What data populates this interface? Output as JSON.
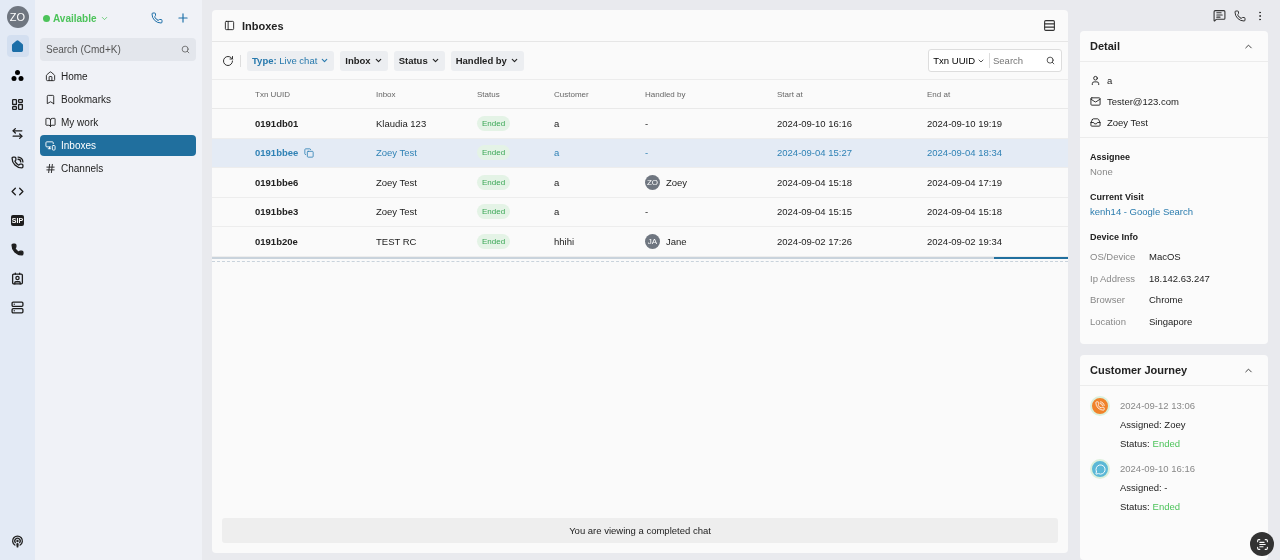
{
  "user": {
    "initials": "ZO"
  },
  "presence": {
    "label": "Available",
    "color": "#4cc35a"
  },
  "rail": {
    "items": [
      {
        "kind": "home",
        "selected": true
      },
      {
        "kind": "nodes",
        "selected": false
      },
      {
        "kind": "dashboard",
        "selected": false
      },
      {
        "kind": "transfer",
        "selected": false
      },
      {
        "kind": "call-log",
        "selected": false
      },
      {
        "kind": "code",
        "selected": false
      },
      {
        "kind": "sip",
        "label": "SIP",
        "selected": false
      },
      {
        "kind": "phone",
        "selected": false
      },
      {
        "kind": "contact",
        "selected": false
      },
      {
        "kind": "storage",
        "selected": false
      }
    ]
  },
  "sidebar": {
    "search": {
      "placeholder": "Search (Cmd+K)"
    },
    "items": [
      {
        "kind": "home",
        "label": "Home",
        "selected": false
      },
      {
        "kind": "bookmark",
        "label": "Bookmarks",
        "selected": false
      },
      {
        "kind": "work",
        "label": "My work",
        "selected": false
      },
      {
        "kind": "inbox",
        "label": "Inboxes",
        "selected": true
      },
      {
        "kind": "hash",
        "label": "Channels",
        "selected": false
      }
    ]
  },
  "main": {
    "title": "Inboxes",
    "filters": [
      {
        "label": "**Type:** Live chat",
        "active": true
      },
      {
        "label": "Inbox",
        "active": false
      },
      {
        "label": "Status",
        "active": false
      },
      {
        "label": "Handled by",
        "active": false
      }
    ],
    "search": {
      "field": "Txn UUID",
      "placeholder": "Search"
    },
    "table": {
      "columns": [
        "Txn UUID",
        "Inbox",
        "Status",
        "Customer",
        "Handled by",
        "Start at",
        "End at"
      ],
      "rows": [
        {
          "selected": false,
          "txn": "0191db01",
          "inbox": "Klaudia 123",
          "status": "Ended",
          "customer": "a",
          "handler": {
            "name": "-"
          },
          "start": "2024-09-10 16:16",
          "end": "2024-09-10 19:19"
        },
        {
          "selected": true,
          "txn": "0191bbee",
          "inbox": "Zoey Test",
          "status": "Ended",
          "customer": "a",
          "handler": {
            "name": "-"
          },
          "start": "2024-09-04 15:27",
          "end": "2024-09-04 18:34"
        },
        {
          "selected": false,
          "txn": "0191bbe6",
          "inbox": "Zoey Test",
          "status": "Ended",
          "customer": "a",
          "handler": {
            "initials": "ZO",
            "name": "Zoey"
          },
          "start": "2024-09-04 15:18",
          "end": "2024-09-04 17:19"
        },
        {
          "selected": false,
          "txn": "0191bbe3",
          "inbox": "Zoey Test",
          "status": "Ended",
          "customer": "a",
          "handler": {
            "name": "-"
          },
          "start": "2024-09-04 15:15",
          "end": "2024-09-04 15:18"
        },
        {
          "selected": false,
          "txn": "0191b20e",
          "inbox": "TEST RC",
          "status": "Ended",
          "customer": "hhihi",
          "handler": {
            "initials": "JA",
            "name": "Jane"
          },
          "start": "2024-09-02 17:26",
          "end": "2024-09-02 19:34"
        }
      ]
    },
    "banner": "You are viewing a completed chat"
  },
  "detail": {
    "title": "Detail",
    "expanded": true,
    "contact": [
      {
        "kind": "person",
        "text": "a"
      },
      {
        "kind": "mail",
        "text": "Tester@123.com"
      },
      {
        "kind": "inbox",
        "text": "Zoey Test"
      }
    ],
    "assignee": {
      "label": "Assignee",
      "value": "None"
    },
    "visit": {
      "label": "Current Visit",
      "link": "kenh14 - Google Search"
    },
    "device": {
      "label": "Device Info",
      "rows": [
        {
          "key": "OS/Device",
          "value": "MacOS"
        },
        {
          "key": "Ip Address",
          "value": "18.142.63.247"
        },
        {
          "key": "Browser",
          "value": "Chrome"
        },
        {
          "key": "Location",
          "value": "Singapore"
        }
      ]
    }
  },
  "journey": {
    "title": "Customer Journey",
    "expanded": true,
    "items": [
      {
        "kind": "call",
        "color": "#f0832a",
        "time": "2024-09-12 13:06",
        "assigned": "Assigned: Zoey",
        "status_label": "Status:",
        "status": "Ended"
      },
      {
        "kind": "chat",
        "color": "#5bb8d6",
        "time": "2024-09-10 16:16",
        "assigned": "Assigned: -",
        "status_label": "Status:",
        "status": "Ended"
      }
    ]
  }
}
